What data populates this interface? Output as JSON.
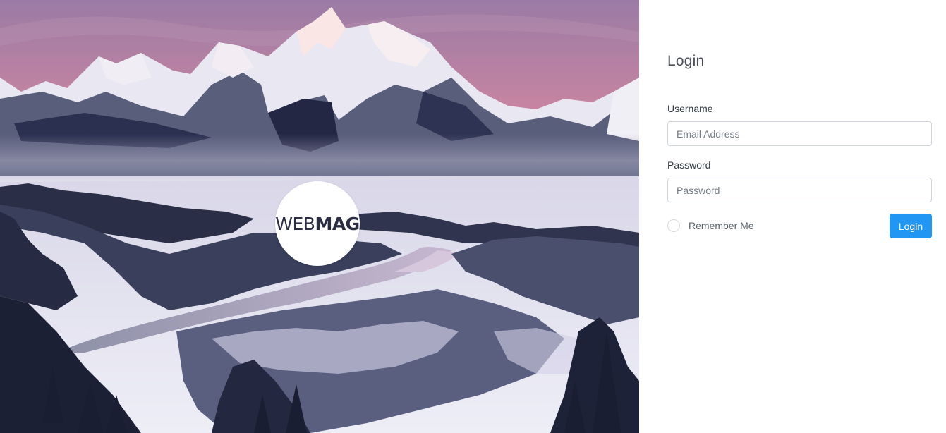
{
  "hero": {
    "background": "mountain-winter-landscape",
    "logo": {
      "light": "WEB",
      "bold": "MAG"
    }
  },
  "login": {
    "title": "Login",
    "username_label": "Username",
    "username_placeholder": "Email Address",
    "username_value": "",
    "password_label": "Password",
    "password_placeholder": "Password",
    "password_value": "",
    "remember_label": "Remember Me",
    "remember_checked": false,
    "submit_label": "Login"
  },
  "colors": {
    "primary": "#2196f3",
    "logo_text": "#2b2d42",
    "sky_top": "#9b7aa6",
    "sky_glow": "#ef9aa8"
  }
}
